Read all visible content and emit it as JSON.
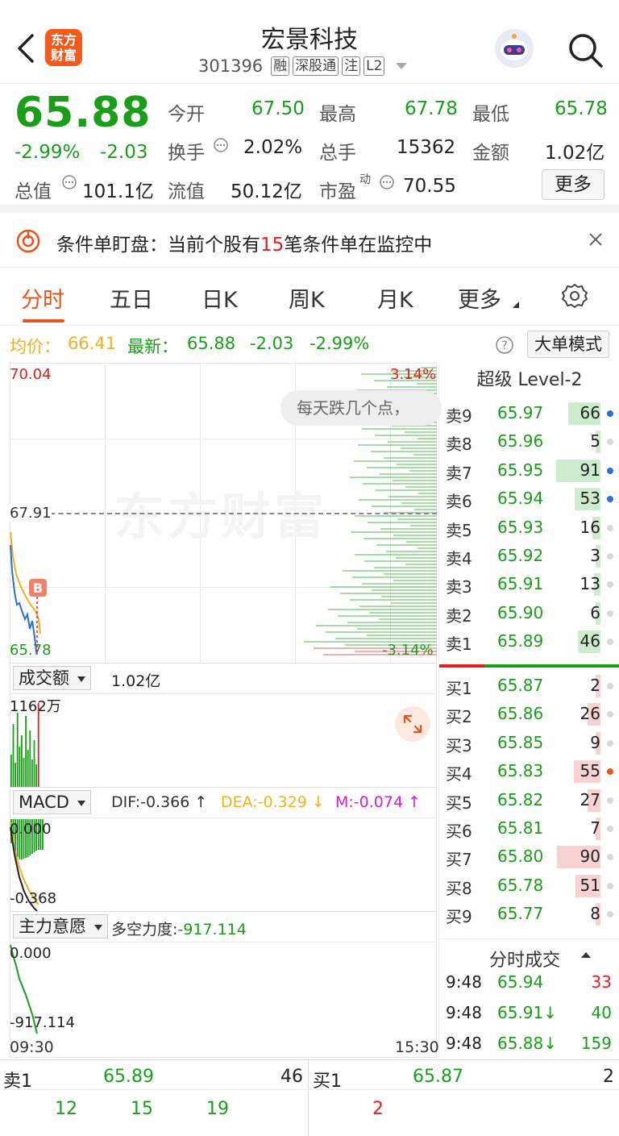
{
  "header": {
    "title": "宏景科技",
    "code": "301396",
    "tags": [
      "融",
      "深股通",
      "注",
      "L2"
    ],
    "logo_line1": "东方",
    "logo_line2": "财富"
  },
  "quote": {
    "price": "65.88",
    "change_pct": "-2.99%",
    "change": "-2.03",
    "open_label": "今开",
    "open": "67.50",
    "high_label": "最高",
    "high": "67.78",
    "low_label": "最低",
    "low": "65.78",
    "turnover_label": "换手",
    "turnover": "2.02%",
    "vol_label": "总手",
    "vol": "15362",
    "amount_label": "金额",
    "amount": "1.02亿",
    "mcap_label": "总值",
    "mcap": "101.1亿",
    "float_label": "流值",
    "float": "50.12亿",
    "pe_label": "市盈",
    "pe_sup": "动",
    "pe": "70.55",
    "more": "更多"
  },
  "alert": {
    "prefix": "条件单盯盘：当前个股有",
    "count": "15",
    "suffix": "笔条件单在监控中"
  },
  "tabs": [
    {
      "label": "分时"
    },
    {
      "label": "五日"
    },
    {
      "label": "日K"
    },
    {
      "label": "周K"
    },
    {
      "label": "月K"
    },
    {
      "label": "更多"
    }
  ],
  "info": {
    "avg_label": "均价：",
    "avg": "66.41",
    "latest_label": "最新：",
    "latest": "65.88",
    "chg": "-2.03",
    "pct": "-2.99%",
    "mode_btn": "大单模式"
  },
  "chart": {
    "top_price": "70.04",
    "top_pct": "3.14%",
    "mid_price": "67.91",
    "bottom_price": "65.78",
    "bottom_pct": "-3.14%",
    "watermark": "东方财富",
    "bubble": "每天跌几个点，",
    "vol_sel": "成交额",
    "vol_val": "1.02亿",
    "vol_max": "1162万",
    "macd_sel": "MACD",
    "dif": "DIF:-0.366 ↑",
    "dea": "DEA:-0.329 ↓",
    "m": "M:-0.074 ↑",
    "macd_top": "0.000",
    "macd_low": "-0.368",
    "ind_sel": "主力意愿",
    "ind_label": "多空力度:",
    "ind_val": "-917.114",
    "ind_top": "0.000",
    "ind_low": "-917.114",
    "time_start": "09:30",
    "time_end": "15:30",
    "buy_marker": "B"
  },
  "orderbook": {
    "title": "超级 Level-2",
    "asks": [
      {
        "l": "卖9",
        "p": "65.97",
        "v": "66"
      },
      {
        "l": "卖8",
        "p": "65.96",
        "v": "5"
      },
      {
        "l": "卖7",
        "p": "65.95",
        "v": "91"
      },
      {
        "l": "卖6",
        "p": "65.94",
        "v": "53"
      },
      {
        "l": "卖5",
        "p": "65.93",
        "v": "16"
      },
      {
        "l": "卖4",
        "p": "65.92",
        "v": "3"
      },
      {
        "l": "卖3",
        "p": "65.91",
        "v": "13"
      },
      {
        "l": "卖2",
        "p": "65.90",
        "v": "6"
      },
      {
        "l": "卖1",
        "p": "65.89",
        "v": "46"
      }
    ],
    "bids": [
      {
        "l": "买1",
        "p": "65.87",
        "v": "2"
      },
      {
        "l": "买2",
        "p": "65.86",
        "v": "26"
      },
      {
        "l": "买3",
        "p": "65.85",
        "v": "9"
      },
      {
        "l": "买4",
        "p": "65.83",
        "v": "55"
      },
      {
        "l": "买5",
        "p": "65.82",
        "v": "27"
      },
      {
        "l": "买6",
        "p": "65.81",
        "v": "7"
      },
      {
        "l": "买7",
        "p": "65.80",
        "v": "90"
      },
      {
        "l": "买8",
        "p": "65.78",
        "v": "51"
      },
      {
        "l": "买9",
        "p": "65.77",
        "v": "8"
      }
    ],
    "trades_title": "分时成交",
    "trades": [
      {
        "t": "9:48",
        "p": "65.94",
        "v": "33"
      },
      {
        "t": "9:48",
        "p": "65.91↓",
        "v": "40"
      },
      {
        "t": "9:48",
        "p": "65.88↓",
        "v": "159"
      }
    ]
  },
  "bottom": {
    "sell_label": "卖1",
    "sell_price": "65.89",
    "sell_vol": "46",
    "buy_label": "买1",
    "buy_price": "65.87",
    "buy_vol": "2",
    "sell_parts": [
      "12",
      "15",
      "19"
    ],
    "buy_parts": [
      "2"
    ]
  },
  "colors": {
    "up": "#e02020",
    "down": "#1a9e1a",
    "accent": "#e8531c",
    "avg_line": "#f0b020"
  }
}
